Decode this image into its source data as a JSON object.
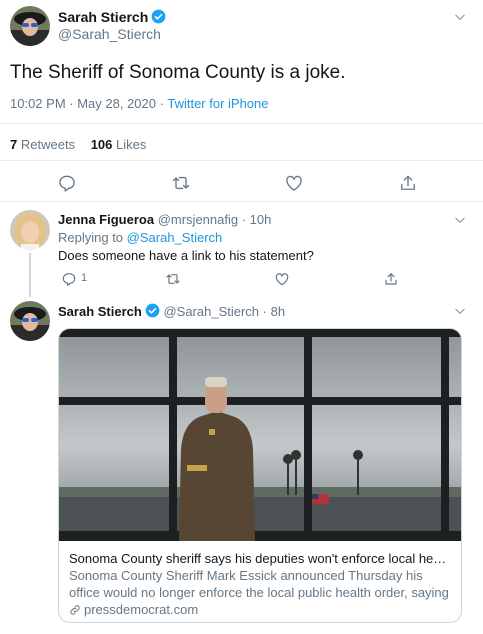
{
  "main_tweet": {
    "author_name": "Sarah Stierch",
    "author_handle": "@Sarah_Stierch",
    "text": "The Sheriff of Sonoma County is a joke.",
    "time": "10:02 PM · May 28, 2020",
    "separator": "·",
    "source": "Twitter for iPhone",
    "retweets_count": "7",
    "retweets_label": "Retweets",
    "likes_count": "106",
    "likes_label": "Likes"
  },
  "reply_1": {
    "author_name": "Jenna Figueroa",
    "author_handle": "@mrsjennafig",
    "age": "· 10h",
    "replying_prefix": "Replying to",
    "replying_to": "@Sarah_Stierch",
    "text": "Does someone have a link to his statement?",
    "reply_count": "1"
  },
  "reply_2": {
    "author_name": "Sarah Stierch",
    "author_handle": "@Sarah_Stierch",
    "age": "· 8h",
    "card": {
      "title": "Sonoma County sheriff says his deputies won't enforce local health o...",
      "description": "Sonoma County Sheriff Mark Essick announced Thursday his office would no longer enforce the local public health order, saying its ...",
      "domain": "pressdemocrat.com"
    }
  },
  "colors": {
    "link": "#1b95e0",
    "muted": "#657786",
    "divider": "#e6ecf0"
  }
}
